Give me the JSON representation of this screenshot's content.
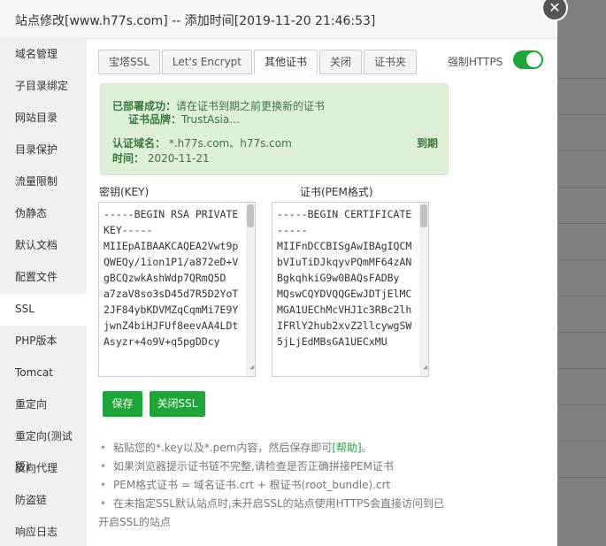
{
  "window": {
    "title": "站点修改[www.h77s.com] -- 添加时间[2019-11-20 21:46:53]",
    "close_symbol": "✕"
  },
  "sidebar": {
    "items": [
      {
        "label": "域名管理"
      },
      {
        "label": "子目录绑定"
      },
      {
        "label": "网站目录"
      },
      {
        "label": "目录保护"
      },
      {
        "label": "流量限制"
      },
      {
        "label": "伪静态"
      },
      {
        "label": "默认文档"
      },
      {
        "label": "配置文件"
      },
      {
        "label": "SSL"
      },
      {
        "label": "PHP版本"
      },
      {
        "label": "Tomcat"
      },
      {
        "label": "重定向"
      },
      {
        "label": "重定向(测试版)"
      },
      {
        "label": "反向代理"
      },
      {
        "label": "防盗链"
      },
      {
        "label": "响应日志"
      }
    ],
    "active": "SSL"
  },
  "tabs": [
    {
      "label": "宝塔SSL"
    },
    {
      "label": "Let's Encrypt"
    },
    {
      "label": "其他证书"
    },
    {
      "label": "关闭"
    },
    {
      "label": "证书夹"
    }
  ],
  "force_https": {
    "label": "强制HTTPS",
    "enabled": true
  },
  "notice": {
    "deployed_label": "已部署成功：",
    "deployed_text": "请在证书到期之前更换新的证书",
    "brand_label": "证书品牌：",
    "brand_value": "TrustAsia...",
    "domain_label": "认证域名：",
    "domain_value": "*.h77s.com、h77s.com",
    "time_label": "时间：",
    "time_value": "2020-11-21",
    "expire_label": "到期"
  },
  "key_field": {
    "label": "密钥(KEY)",
    "value": "-----BEGIN RSA PRIVATE KEY-----\nMIIEpAIBAAKCAQEA2Vwt9pQWEQy/1ion1P1/a872eD+VgBCQzwkAshWdp7QRmQ5D\na7zaV8so3sD45d7R5D2YoT2JF84ybKDVMZqCqmMi7E9YjwnZ4biHJFUf8eevAA4LDtAsyzr+4o9V+q5pgDDcy"
  },
  "cert_field": {
    "label": "证书(PEM格式)",
    "value": "-----BEGIN CERTIFICATE-----\nMIIFnDCCBISgAwIBAgIQCMbVIuTiDJkqyvPQmMF64zANBgkqhkiG9w0BAQsFADBy\nMQswCQYDVQQGEwJDTjElMCMGA1UEChMcVHJ1c3RBc2lhIFRlY2hub2xvZ2llcywgSW5jLjEdMBsGA1UECxMU"
  },
  "buttons": {
    "save": "保存",
    "close_ssl": "关闭SSL"
  },
  "tips": [
    {
      "pre": "粘贴您的*.key以及*.pem内容，然后保存即可",
      "link": "[帮助]",
      "post": "。"
    },
    {
      "text": "如果浏览器提示证书链不完整,请检查是否正确拼接PEM证书"
    },
    {
      "text": "PEM格式证书 = 域名证书.crt + 根证书(root_bundle).crt"
    },
    {
      "line1": "在未指定SSL默认站点时,未开启SSL的站点使用HTTPS会直接访问到已",
      "line2": "开启SSL的站点"
    }
  ],
  "colors": {
    "accent": "#20a53a",
    "notice_bg": "#dff0d8",
    "notice_text": "#3c763d"
  }
}
